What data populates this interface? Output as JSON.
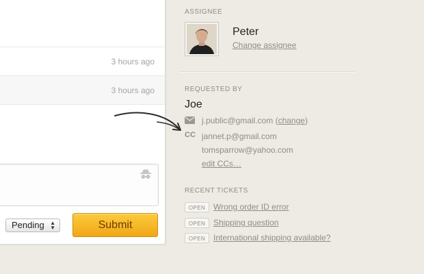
{
  "conversation": {
    "rows": [
      {
        "time": "3 hours ago"
      },
      {
        "time": "3 hours ago"
      }
    ]
  },
  "reply": {
    "status_value": "Pending",
    "submit_label": "Submit"
  },
  "assignee": {
    "heading": "ASSIGNEE",
    "name": "Peter",
    "change_link": "Change assignee"
  },
  "requester": {
    "heading": "REQUESTED BY",
    "name": "Joe",
    "email": "j.public@gmail.com",
    "change_open": "(",
    "change_link": "change",
    "change_close": ")",
    "cc_label": "CC",
    "cc_emails": [
      "jannet.p@gmail.com",
      "tomsparrow@yahoo.com"
    ],
    "edit_cc_link": "edit CCs…"
  },
  "recent_tickets": {
    "heading": "RECENT TICKETS",
    "items": [
      {
        "status": "OPEN",
        "title": "Wrong order ID error"
      },
      {
        "status": "OPEN",
        "title": "Shipping question"
      },
      {
        "status": "OPEN",
        "title": "International shipping available?"
      }
    ]
  },
  "colors": {
    "background": "#edebe4",
    "submit": "#f5b424",
    "muted_text": "#8e8c86"
  }
}
